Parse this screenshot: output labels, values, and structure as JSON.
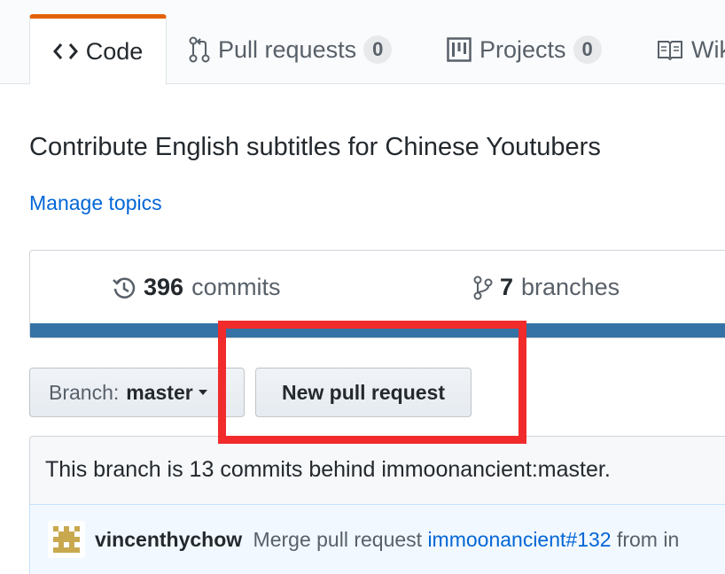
{
  "tabs": [
    {
      "label": "Code",
      "icon": "code-icon",
      "selected": true
    },
    {
      "label": "Pull requests",
      "icon": "git-pull-request-icon",
      "count": "0"
    },
    {
      "label": "Projects",
      "icon": "project-icon",
      "count": "0"
    },
    {
      "label": "Wiki",
      "icon": "book-icon"
    }
  ],
  "repo": {
    "description": "Contribute English subtitles for Chinese Youtubers",
    "manage_topics": "Manage topics"
  },
  "summary": {
    "commits_count": "396",
    "commits_label": "commits",
    "branches_count": "7",
    "branches_label": "branches",
    "language_color": "#3572a5"
  },
  "branch_select": {
    "prefix": "Branch:",
    "value": "master"
  },
  "new_pr_button": "New pull request",
  "branch_status": "This branch is 13 commits behind immoonancient:master.",
  "latest_commit": {
    "author": "vincenthychow",
    "message_prefix": "Merge pull request",
    "link": "immoonancient#132",
    "message_suffix": "from in"
  },
  "colors": {
    "accent_tab": "#e36209",
    "link": "#0366d6",
    "highlight": "#f12b2b"
  }
}
